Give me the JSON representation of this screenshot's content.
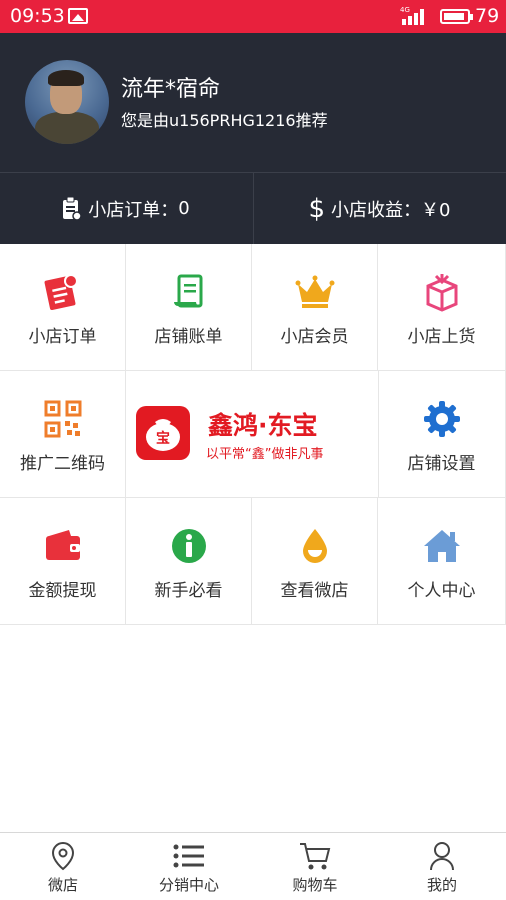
{
  "status_bar": {
    "time": "09:53",
    "network": "4G",
    "battery": "79"
  },
  "profile": {
    "name": "流年*宿命",
    "referral": "您是由u156PRHG1216推荐"
  },
  "stats": {
    "orders": {
      "label": "小店订单：",
      "value": "0"
    },
    "earnings": {
      "label": "小店收益：",
      "value": "￥0"
    }
  },
  "grid": [
    {
      "label": "小店订单",
      "icon": "order-document-icon",
      "color": "#e8313b"
    },
    {
      "label": "店铺账单",
      "icon": "scroll-bill-icon",
      "color": "#2aa84a"
    },
    {
      "label": "小店会员",
      "icon": "crown-icon",
      "color": "#f0a81c"
    },
    {
      "label": "小店上货",
      "icon": "box-icon",
      "color": "#e8467c"
    },
    {
      "label": "推广二维码",
      "icon": "qr-code-icon",
      "color": "#ef7d2b"
    },
    {
      "label": "店铺设置",
      "icon": "gear-icon",
      "color": "#1f6fd0"
    },
    {
      "label": "金额提现",
      "icon": "wallet-icon",
      "color": "#e8313b"
    },
    {
      "label": "新手必看",
      "icon": "info-icon",
      "color": "#2aa84a"
    },
    {
      "label": "查看微店",
      "icon": "drop-icon",
      "color": "#f0a81c"
    },
    {
      "label": "个人中心",
      "icon": "home-icon",
      "color": "#6b9cd6"
    }
  ],
  "brand": {
    "name": "鑫鸿·东宝",
    "slogan": "以平常“鑫”做非凡事",
    "seal_char": "宝",
    "color": "#e21a22"
  },
  "tabs": [
    {
      "label": "微店",
      "icon": "location-pin-icon"
    },
    {
      "label": "分销中心",
      "icon": "list-icon"
    },
    {
      "label": "购物车",
      "icon": "cart-icon"
    },
    {
      "label": "我的",
      "icon": "person-icon"
    }
  ]
}
